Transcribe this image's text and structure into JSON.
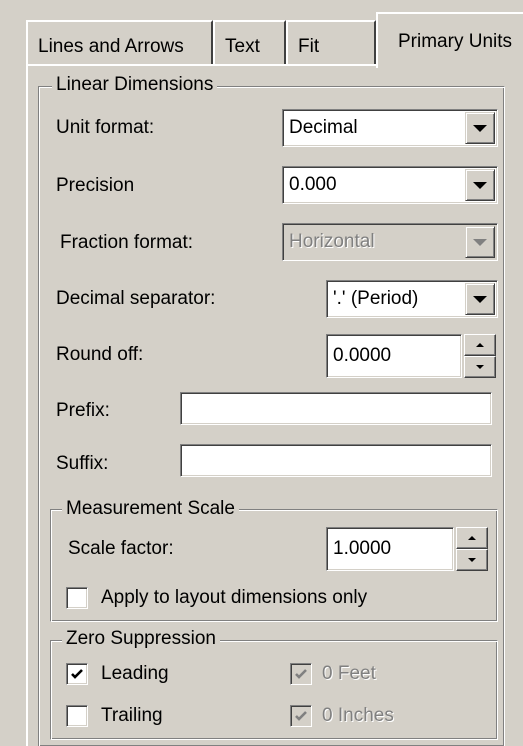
{
  "tabs": [
    {
      "label": "Lines and Arrows"
    },
    {
      "label": "Text"
    },
    {
      "label": "Fit"
    },
    {
      "label": "Primary Units"
    }
  ],
  "linear": {
    "title": "Linear Dimensions",
    "unit_format": {
      "label": "Unit format:",
      "value": "Decimal"
    },
    "precision": {
      "label": "Precision",
      "value": "0.000"
    },
    "fraction_format": {
      "label": "Fraction format:",
      "value": "Horizontal"
    },
    "decimal_separator": {
      "label": "Decimal separator:",
      "value": "'.' (Period)"
    },
    "round_off": {
      "label": "Round off:",
      "value": "0.0000"
    },
    "prefix": {
      "label": "Prefix:",
      "value": ""
    },
    "suffix": {
      "label": "Suffix:",
      "value": ""
    }
  },
  "measurement": {
    "title": "Measurement Scale",
    "scale_factor": {
      "label": "Scale factor:",
      "value": "1.0000"
    },
    "apply_layout": {
      "label": "Apply to layout dimensions only",
      "checked": false
    }
  },
  "zero": {
    "title": "Zero Suppression",
    "leading": {
      "label": "Leading",
      "checked": true
    },
    "trailing": {
      "label": "Trailing",
      "checked": false
    },
    "feet": {
      "label": "0 Feet",
      "checked": true
    },
    "inches": {
      "label": "0 Inches",
      "checked": true
    }
  },
  "colors": {
    "face": "#d4d0c8",
    "shadow": "#808080",
    "highlight": "#ffffff"
  }
}
